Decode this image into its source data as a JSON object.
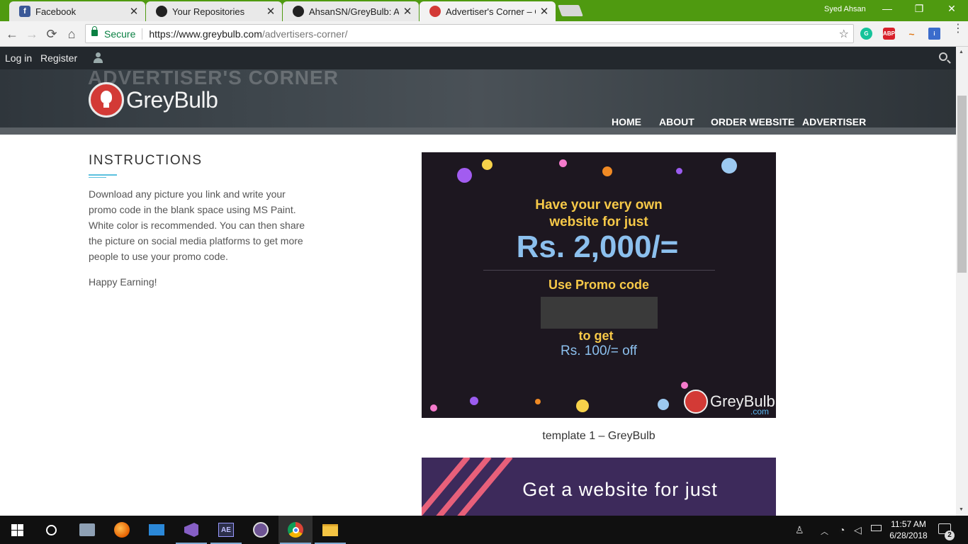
{
  "browser": {
    "tabs": [
      {
        "title": "Facebook",
        "icon": "facebook-icon",
        "color": "#3b5998",
        "glyph": "f"
      },
      {
        "title": "Your Repositories",
        "icon": "github-icon",
        "color": "#222222",
        "glyph": ""
      },
      {
        "title": "AhsanSN/GreyBulb: A bu",
        "icon": "github-icon",
        "color": "#222222",
        "glyph": ""
      },
      {
        "title": "Advertiser's Corner – Gre",
        "icon": "greybulb-icon",
        "color": "#d33a36",
        "glyph": ""
      }
    ],
    "close_glyph": "✕",
    "user": "Syed Ahsan",
    "win_controls": {
      "minimize": "—",
      "restore": "❐",
      "close": "✕"
    },
    "nav": {
      "back": "←",
      "forward": "→",
      "reload": "⟳",
      "home": "⌂"
    },
    "secure_label": "Secure",
    "url_host": "https://www.greybulb.com",
    "url_path": "/advertisers-corner/",
    "star": "☆",
    "extensions": [
      {
        "name": "grammarly-icon",
        "color": "#15c39a",
        "label": "G"
      },
      {
        "name": "adblock-plus-icon",
        "color": "#d8202a",
        "label": "ABP"
      },
      {
        "name": "rainbow-extension-icon",
        "color": "#e07b1c",
        "label": "~"
      },
      {
        "name": "blue-extension-icon",
        "color": "#3b6ccc",
        "label": "i"
      }
    ],
    "menu": "⋮"
  },
  "site": {
    "admin_bar": {
      "login": "Log in",
      "register": "Register"
    },
    "hero_title": "ADVERTISER'S CORNER",
    "logo_text": "GreyBulb",
    "nav": [
      "HOME",
      "ABOUT",
      "ORDER WEBSITE",
      "ADVERTISER"
    ],
    "instructions": {
      "title": "INSTRUCTIONS",
      "body": "Download any picture you link and write your promo code in the blank space using MS Paint. White color is recommended. You can then share the picture on social media platforms to get more people to use your promo code.",
      "closing": "Happy Earning!"
    },
    "promo1": {
      "line1": "Have your very own",
      "line2": "website for just",
      "price": "Rs. 2,000/=",
      "use_code": "Use Promo code",
      "to_get": "to get",
      "off": "Rs. 100/= off",
      "logo": "GreyBulb",
      "domain": ".com"
    },
    "caption": "template 1 – GreyBulb",
    "promo2": {
      "text": "Get a website for just"
    }
  },
  "taskbar": {
    "apps": [
      "windows-start-icon",
      "cortana-icon",
      "file-viewer-icon",
      "firefox-icon",
      "remote-desktop-icon",
      "visual-studio-icon",
      "after-effects-icon",
      "github-desktop-icon",
      "chrome-icon",
      "file-explorer-icon"
    ],
    "time": "11:57 AM",
    "date": "6/28/2018",
    "notifications": "2"
  },
  "colors": {
    "browser_frame": "#4f9a10",
    "brand_red": "#d33a36",
    "promo_yellow": "#f7c948",
    "promo_blue": "#8cc0ee",
    "accent_cyan": "#5bc0de"
  }
}
